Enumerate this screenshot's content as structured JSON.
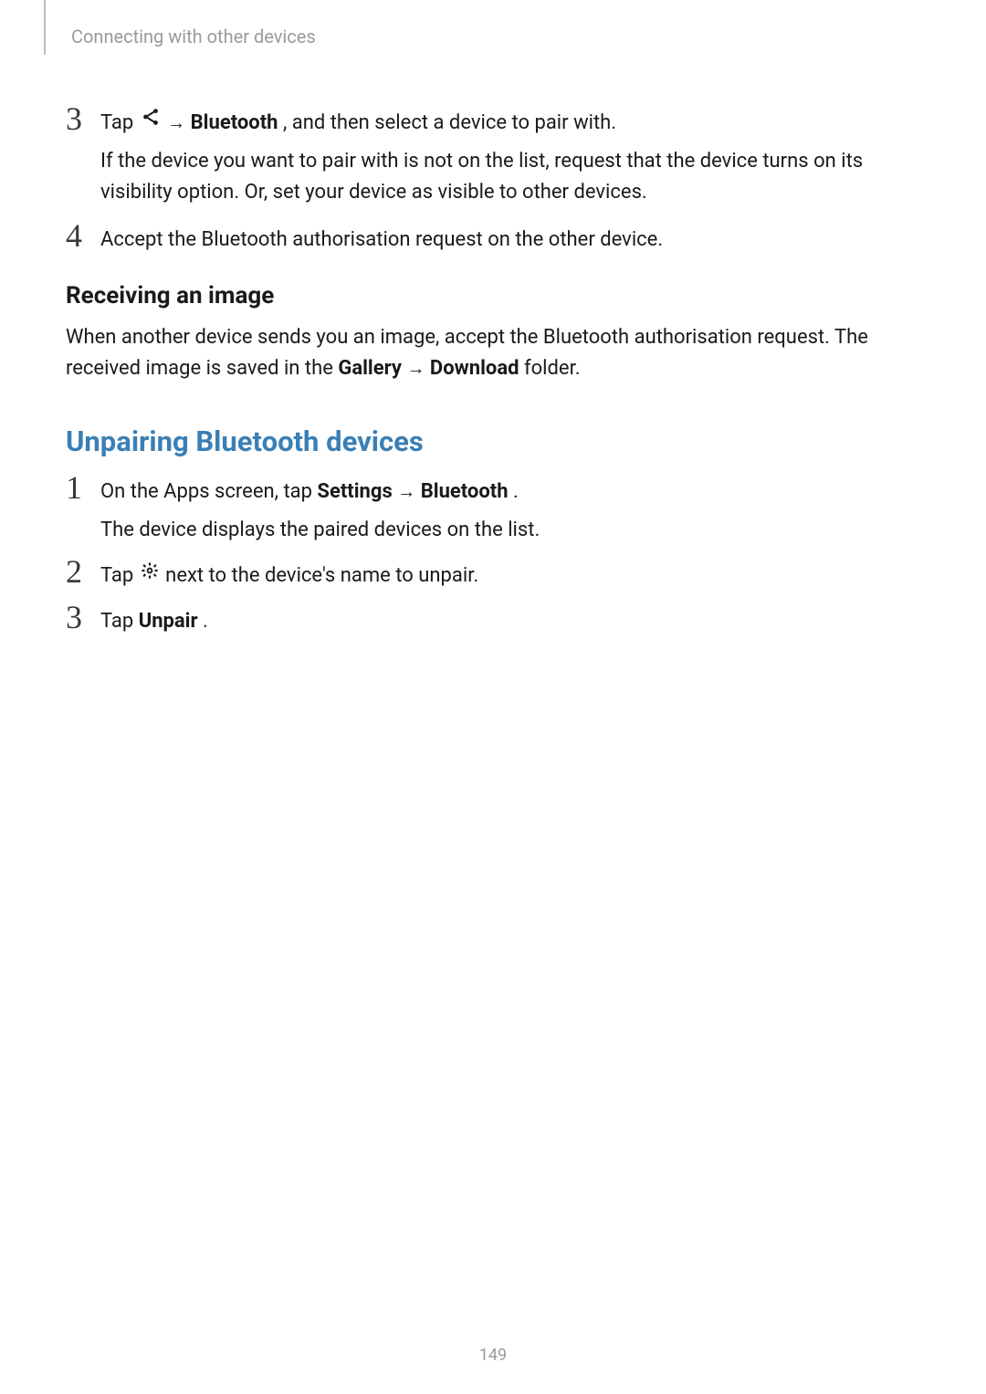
{
  "header": {
    "chapter": "Connecting with other devices"
  },
  "step3": {
    "num": "3",
    "line1_a": "Tap ",
    "line1_arrow": " → ",
    "line1_bold": "Bluetooth",
    "line1_c": ", and then select a device to pair with.",
    "line2": "If the device you want to pair with is not on the list, request that the device turns on its visibility option. Or, set your device as visible to other devices."
  },
  "step4": {
    "num": "4",
    "text": "Accept the Bluetooth authorisation request on the other device."
  },
  "receiving": {
    "heading": "Receiving an image",
    "para_a": "When another device sends you an image, accept the Bluetooth authorisation request. The received image is saved in the ",
    "para_b1": "Gallery",
    "arrow": " → ",
    "para_b2": "Download",
    "para_c": " folder."
  },
  "unpairing": {
    "heading": "Unpairing Bluetooth devices",
    "step1": {
      "num": "1",
      "a": "On the Apps screen, tap ",
      "b1": "Settings",
      "arrow": " → ",
      "b2": "Bluetooth",
      "c": ".",
      "d": "The device displays the paired devices on the list."
    },
    "step2": {
      "num": "2",
      "a": "Tap ",
      "b": " next to the device's name to unpair."
    },
    "step3": {
      "num": "3",
      "a": "Tap ",
      "b": "Unpair",
      "c": "."
    }
  },
  "footer": {
    "page": "149"
  }
}
